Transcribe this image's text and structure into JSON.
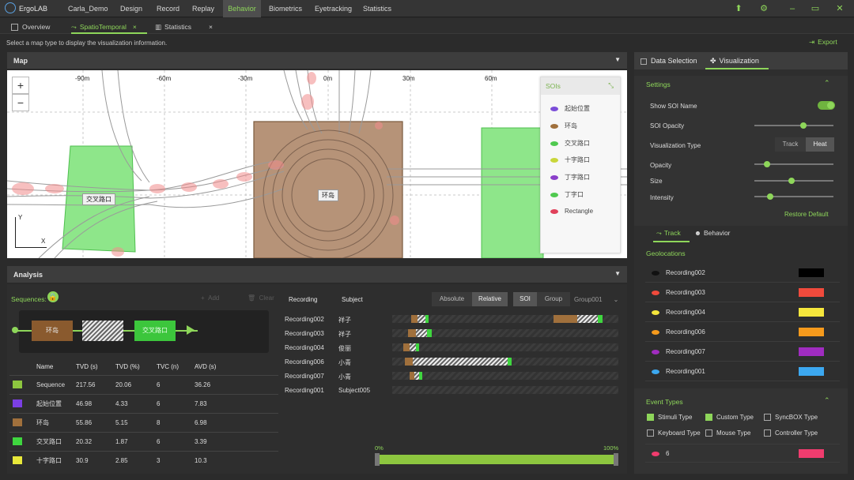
{
  "app": {
    "name": "ErgoLAB"
  },
  "menu": [
    "Carla_Demo",
    "Design",
    "Record",
    "Replay",
    "Behavior",
    "Biometrics",
    "Eyetracking",
    "Statistics"
  ],
  "tabs": [
    {
      "label": "Overview"
    },
    {
      "label": "SpatioTemporal"
    },
    {
      "label": "Statistics"
    }
  ],
  "hint": "Select a map type to display the visualization information.",
  "export_label": "Export",
  "map": {
    "title": "Map",
    "ticks": [
      "-90m",
      "-60m",
      "-30m",
      "0m",
      "30m",
      "60m"
    ],
    "labels": {
      "jiaochakou": "交叉路口",
      "huandao": "环岛"
    },
    "axis_y": "Y",
    "axis_x": "X",
    "soi_title": "SOIs",
    "sois": [
      {
        "name": "起始位置",
        "color": "#7b4dd8"
      },
      {
        "name": "环岛",
        "color": "#a0703c"
      },
      {
        "name": "交叉路口",
        "color": "#4fc94f"
      },
      {
        "name": "十字路口",
        "color": "#c9d63a"
      },
      {
        "name": "丁字路口",
        "color": "#8a3fc9"
      },
      {
        "name": "丁字口",
        "color": "#4fc94f"
      },
      {
        "name": "Rectangle",
        "color": "#e0405a"
      }
    ]
  },
  "analysis": {
    "title": "Analysis",
    "sequences_label": "Sequences:",
    "add_label": "Add",
    "clear_label": "Clear",
    "seq_boxes": [
      "环岛",
      "",
      "交叉路口"
    ],
    "columns": [
      "Name",
      "TVD (s)",
      "TVD (%)",
      "TVC (n)",
      "AVD (s)"
    ],
    "rows": [
      {
        "name": "Sequence",
        "tvd_s": "217.56",
        "tvd_p": "20.06",
        "tvc": "6",
        "avd": "36.26",
        "color": "#8dc63f"
      },
      {
        "name": "起始位置",
        "tvd_s": "46.98",
        "tvd_p": "4.33",
        "tvc": "6",
        "avd": "7.83",
        "color": "#7b3fe4"
      },
      {
        "name": "环岛",
        "tvd_s": "55.86",
        "tvd_p": "5.15",
        "tvc": "8",
        "avd": "6.98",
        "color": "#a0703c"
      },
      {
        "name": "交叉路口",
        "tvd_s": "20.32",
        "tvd_p": "1.87",
        "tvc": "6",
        "avd": "3.39",
        "color": "#3fd63f"
      },
      {
        "name": "十字路口",
        "tvd_s": "30.9",
        "tvd_p": "2.85",
        "tvc": "3",
        "avd": "10.3",
        "color": "#e8e83a"
      }
    ],
    "rec_header": {
      "recording": "Recording",
      "subject": "Subject"
    },
    "buttons": [
      "Absolute",
      "Relative",
      "SOI",
      "Group",
      "Group001"
    ],
    "recordings": [
      {
        "rec": "Recording002",
        "subject": "祥子"
      },
      {
        "rec": "Recording003",
        "subject": "祥子"
      },
      {
        "rec": "Recording004",
        "subject": "俊丽"
      },
      {
        "rec": "Recording006",
        "subject": "小青"
      },
      {
        "rec": "Recording007",
        "subject": "小青"
      },
      {
        "rec": "Recording001",
        "subject": "Subject005"
      }
    ],
    "range_min": "0%",
    "range_max": "100%"
  },
  "right": {
    "tab_data": "Data Selection",
    "tab_vis": "Visualization",
    "settings_title": "Settings",
    "show_soi_name": "Show SOI Name",
    "soi_opacity": "SOI Opacity",
    "vis_type": "Visualization Type",
    "vis_track": "Track",
    "vis_heat": "Heat",
    "opacity": "Opacity",
    "size": "Size",
    "intensity": "Intensity",
    "restore": "Restore Default",
    "sub_track": "Track",
    "sub_behavior": "Behavior",
    "geo_title": "Geolocations",
    "geolocations": [
      {
        "name": "Recording002",
        "color": "#000000",
        "eye": "#111111"
      },
      {
        "name": "Recording003",
        "color": "#f04a3c",
        "eye": "#f04a3c"
      },
      {
        "name": "Recording004",
        "color": "#f5e63c",
        "eye": "#f5e63c"
      },
      {
        "name": "Recording006",
        "color": "#f59a1c",
        "eye": "#f59a1c"
      },
      {
        "name": "Recording007",
        "color": "#a02cc0",
        "eye": "#a02cc0"
      },
      {
        "name": "Recording001",
        "color": "#3ca8f0",
        "eye": "#3ca8f0"
      }
    ],
    "event_title": "Event Types",
    "events": [
      {
        "label": "Stimuli Type",
        "on": true
      },
      {
        "label": "Custom Type",
        "on": true
      },
      {
        "label": "SyncBOX Type",
        "on": false
      },
      {
        "label": "Keyboard Type",
        "on": false
      },
      {
        "label": "Mouse Type",
        "on": false
      },
      {
        "label": "Controller Type",
        "on": false
      }
    ],
    "event_item": "6",
    "event_item_color": "#f03c6e"
  }
}
